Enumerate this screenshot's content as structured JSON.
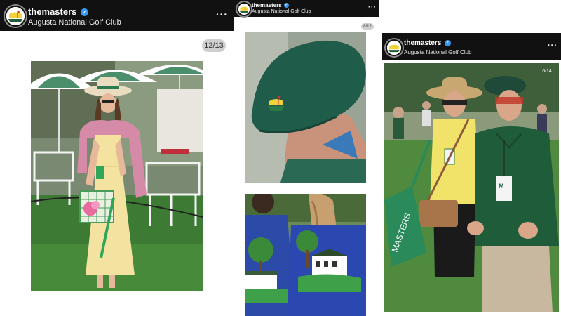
{
  "posts": [
    {
      "username": "themasters",
      "verified_icon": "verified-badge-icon",
      "subtitle": "Augusta National Golf Club",
      "more_icon": "more-options-icon",
      "counter": "12/13"
    },
    {
      "username": "themasters",
      "verified_icon": "verified-badge-icon",
      "subtitle": "Augusta National Golf Club",
      "more_icon": "more-options-icon",
      "counter": "8/12"
    },
    {
      "username": "themasters",
      "verified_icon": "verified-badge-icon",
      "subtitle": "Augusta National Golf Club",
      "more_icon": "more-options-icon",
      "counter": "6/14"
    }
  ],
  "photo_texts": {
    "tote_bag_print": "MASTERS",
    "badge_text": "M"
  },
  "colors": {
    "header_bg": "#111111",
    "verified_blue": "#3897f0",
    "masters_green": "#1f5c3a",
    "masters_yellow": "#f4d23c"
  }
}
